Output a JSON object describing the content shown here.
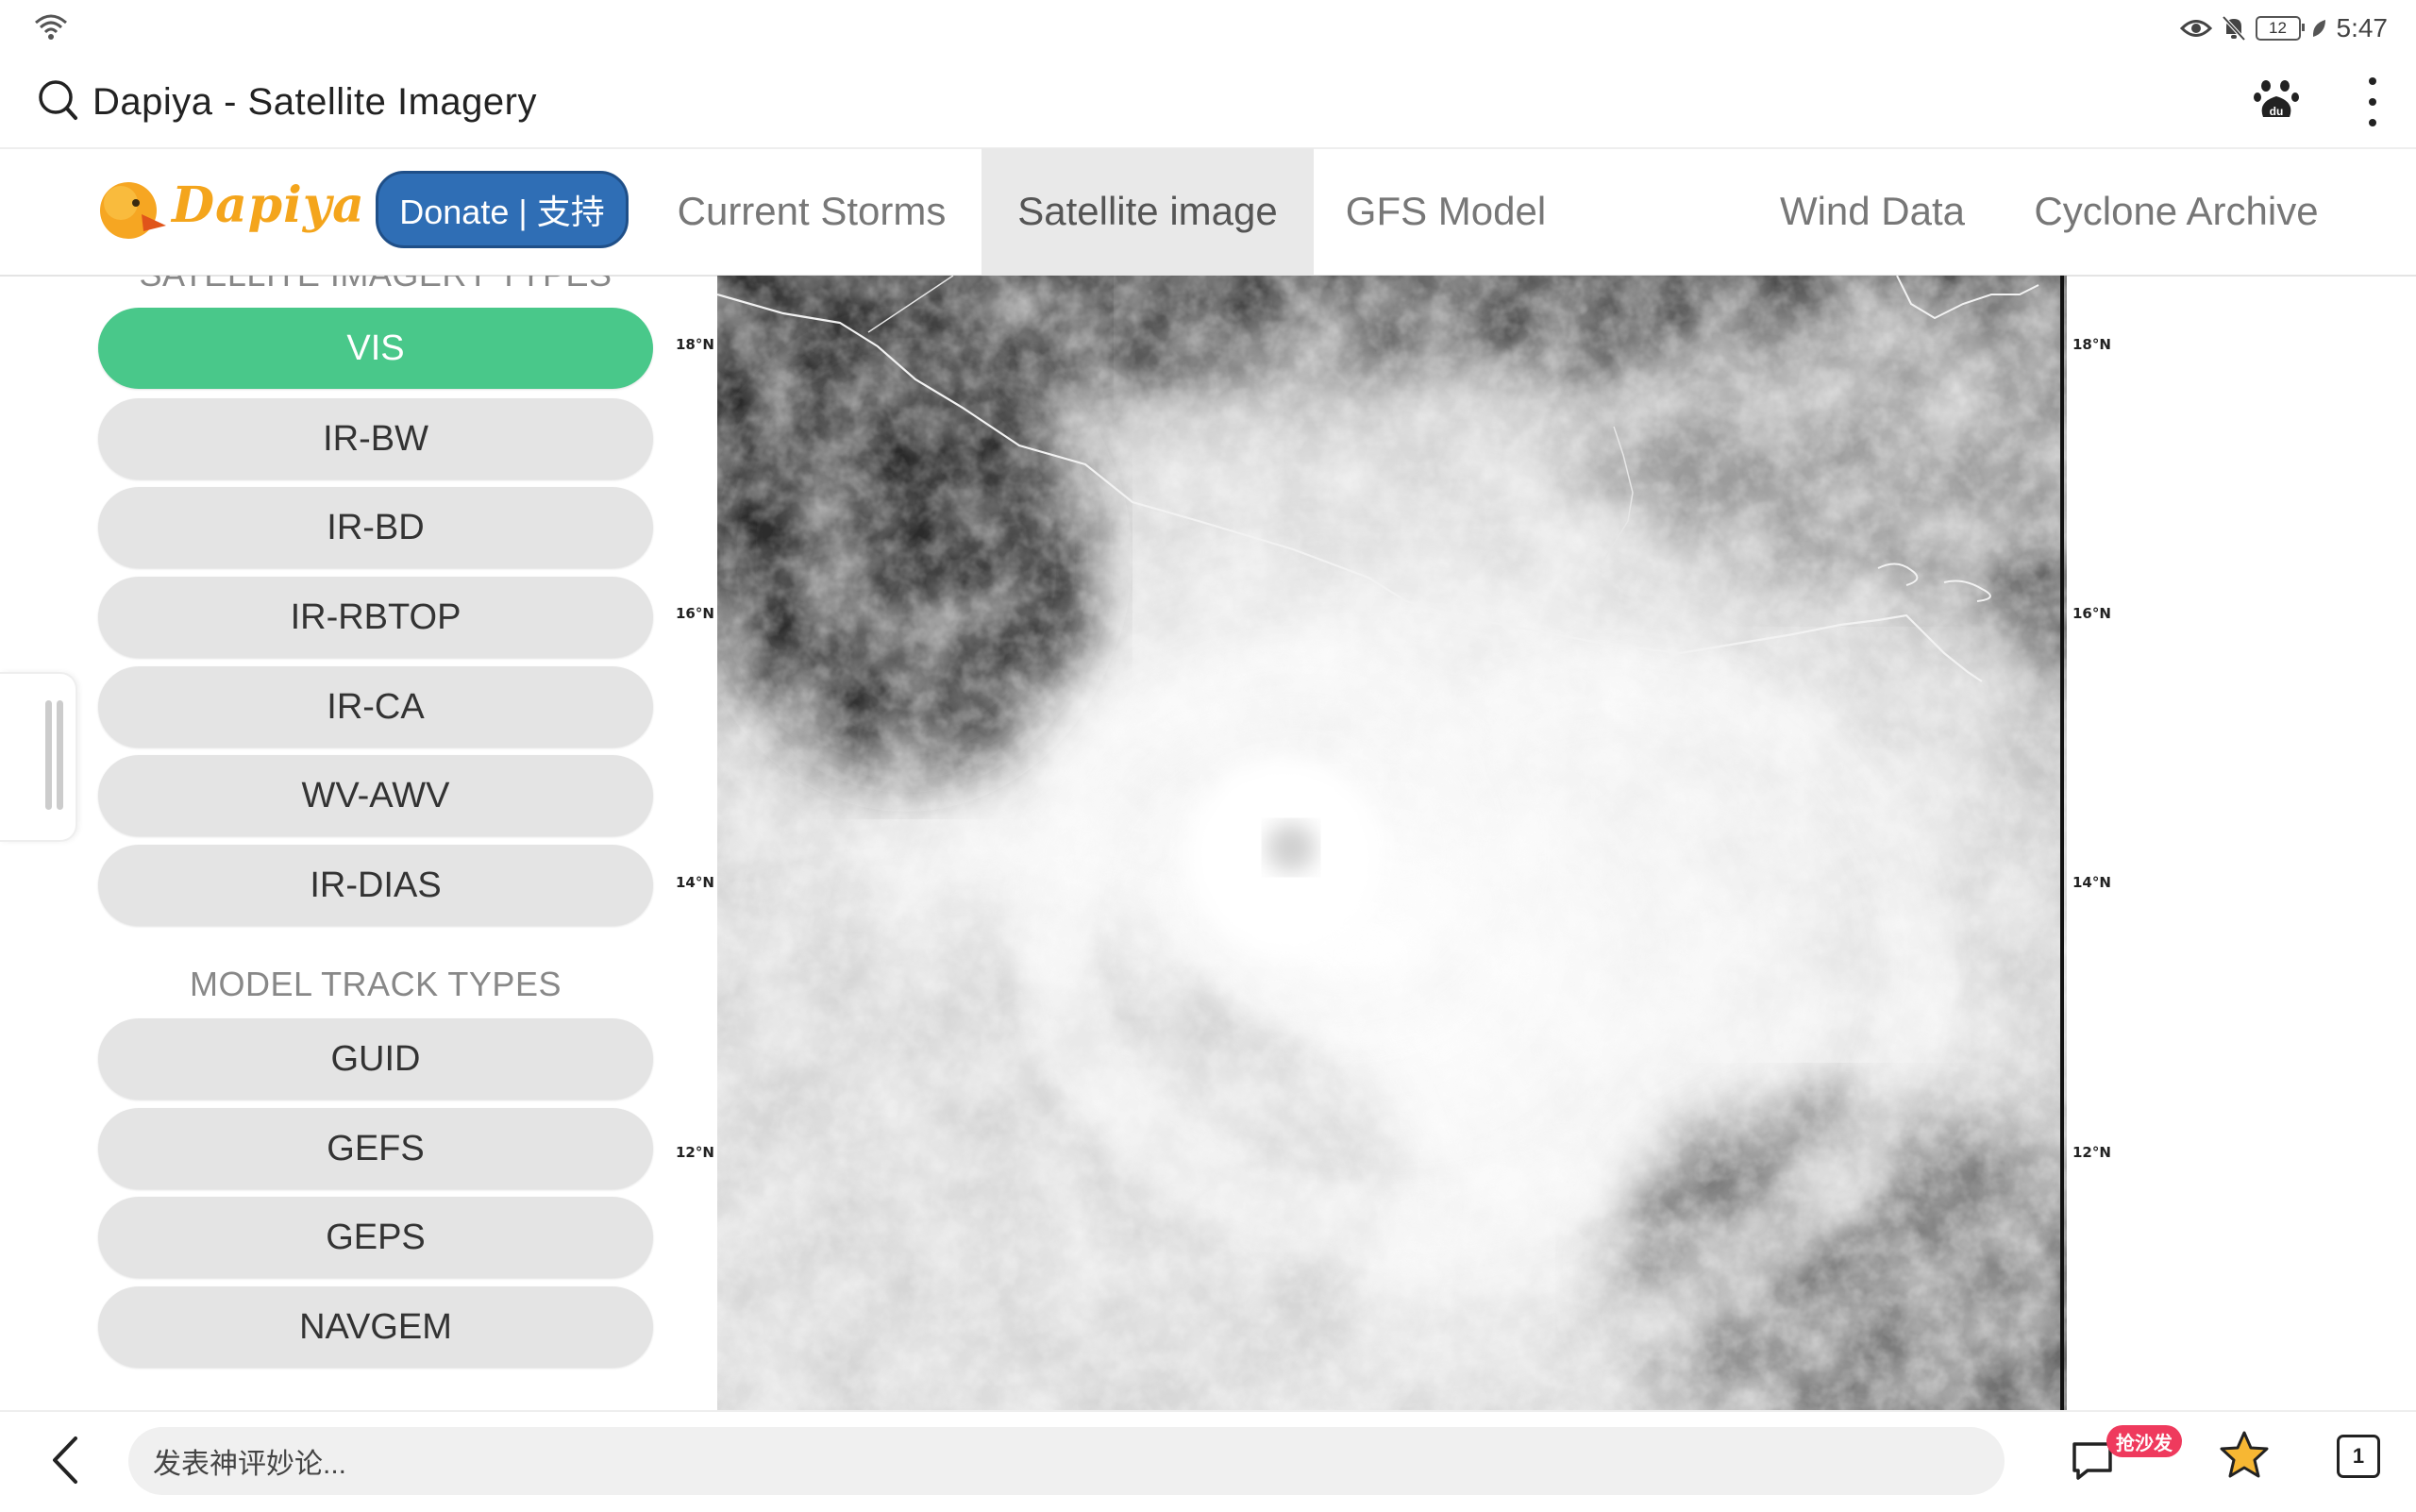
{
  "status_bar": {
    "time": "5:47",
    "battery": "12"
  },
  "browser": {
    "page_title": "Dapiya - Satellite Imagery"
  },
  "site": {
    "logo_text": "Dapiya",
    "donate_label": "Donate | 支持",
    "nav": [
      "Current Storms",
      "Satellite image",
      "GFS Model",
      "Wind Data",
      "Cyclone Archive"
    ],
    "active_nav": "Satellite image"
  },
  "sidebar": {
    "imagery_heading": "SATELLITE IMAGERY TYPES",
    "imagery_types": [
      "VIS",
      "IR-BW",
      "IR-BD",
      "IR-RBTOP",
      "IR-CA",
      "WV-AWV",
      "IR-DIAS"
    ],
    "active_imagery": "VIS",
    "model_heading": "MODEL TRACK TYPES",
    "model_types": [
      "GUID",
      "GEFS",
      "GEPS",
      "NAVGEM"
    ]
  },
  "satellite": {
    "lat_labels": [
      "18°N",
      "16°N",
      "14°N",
      "12°N"
    ]
  },
  "bottom_bar": {
    "comment_placeholder": "发表神评妙论...",
    "comment_badge": "抢沙发",
    "tab_count": "1"
  },
  "colors": {
    "accent_green": "#49c88a",
    "donate_blue": "#2f6eb5",
    "logo_orange": "#f4a51c"
  }
}
